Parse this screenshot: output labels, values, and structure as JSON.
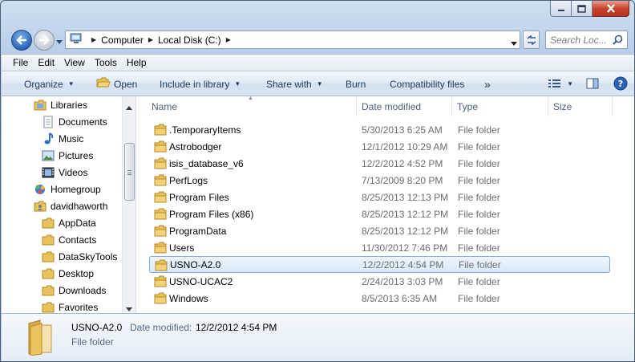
{
  "window": {
    "caption": {
      "minimize": "minimize-icon",
      "maximize": "maximize-icon",
      "close": "close-icon"
    }
  },
  "navigation": {
    "breadcrumbs": [
      "Computer",
      "Local Disk (C:)"
    ],
    "search_placeholder": "Search Loc..."
  },
  "menubar": {
    "items": [
      "File",
      "Edit",
      "View",
      "Tools",
      "Help"
    ]
  },
  "toolbar": {
    "organize": "Organize",
    "open": "Open",
    "include_in_library": "Include in library",
    "share_with": "Share with",
    "burn": "Burn",
    "compatibility_files": "Compatibility files",
    "more": "»"
  },
  "nav_pane": {
    "items": [
      {
        "label": "Libraries",
        "icon": "libraries-icon"
      },
      {
        "label": "Documents",
        "icon": "documents-icon"
      },
      {
        "label": "Music",
        "icon": "music-icon"
      },
      {
        "label": "Pictures",
        "icon": "pictures-icon"
      },
      {
        "label": "Videos",
        "icon": "videos-icon"
      },
      {
        "label": "Homegroup",
        "icon": "homegroup-icon"
      },
      {
        "label": "davidhaworth",
        "icon": "user-folder-icon"
      },
      {
        "label": "AppData",
        "icon": "folder-icon"
      },
      {
        "label": "Contacts",
        "icon": "folder-icon"
      },
      {
        "label": "DataSkyTools",
        "icon": "folder-icon"
      },
      {
        "label": "Desktop",
        "icon": "folder-icon"
      },
      {
        "label": "Downloads",
        "icon": "folder-icon"
      },
      {
        "label": "Favorites",
        "icon": "folder-icon"
      }
    ]
  },
  "file_list": {
    "columns": [
      "Name",
      "Date modified",
      "Type",
      "Size"
    ],
    "rows": [
      {
        "name": ".TemporaryItems",
        "date": "5/30/2013 6:25 AM",
        "type": "File folder"
      },
      {
        "name": "Astrobodger",
        "date": "12/1/2012 10:29 AM",
        "type": "File folder"
      },
      {
        "name": "isis_database_v6",
        "date": "12/2/2012 4:52 PM",
        "type": "File folder"
      },
      {
        "name": "PerfLogs",
        "date": "7/13/2009 8:20 PM",
        "type": "File folder"
      },
      {
        "name": "Program Files",
        "date": "8/25/2013 12:13 PM",
        "type": "File folder"
      },
      {
        "name": "Program Files (x86)",
        "date": "8/25/2013 12:12 PM",
        "type": "File folder"
      },
      {
        "name": "ProgramData",
        "date": "8/25/2013 12:12 PM",
        "type": "File folder"
      },
      {
        "name": "Users",
        "date": "11/30/2012 7:46 PM",
        "type": "File folder"
      },
      {
        "name": "USNO-A2.0",
        "date": "12/2/2012 4:54 PM",
        "type": "File folder",
        "selected": true
      },
      {
        "name": "USNO-UCAC2",
        "date": "2/24/2013 3:03 PM",
        "type": "File folder"
      },
      {
        "name": "Windows",
        "date": "8/5/2013 6:35 AM",
        "type": "File folder"
      }
    ]
  },
  "details": {
    "name": "USNO-A2.0",
    "date_label": "Date modified:",
    "date_value": "12/2/2012 4:54 PM",
    "type": "File folder"
  },
  "colors": {
    "selection_border": "#84acdd",
    "toolbar_text": "#1e395b",
    "folder_yellow": "#e8c25a"
  }
}
